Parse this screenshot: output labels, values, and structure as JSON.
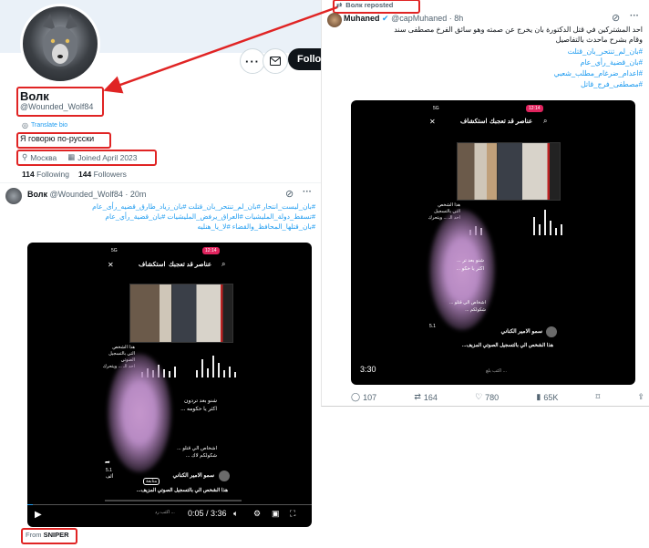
{
  "profile": {
    "display_name": "Волк",
    "handle": "@Wounded_Wolf84",
    "translate_bio": "Translate bio",
    "bio": "Я говорю по-русски",
    "location": "Москва",
    "joined": "Joined April 2023",
    "following_count": "114",
    "following_label": "Following",
    "followers_count": "144",
    "followers_label": "Followers",
    "follow_label": "Follow"
  },
  "tweet1": {
    "author": "Волк",
    "handle_time": "@Wounded_Wolf84 · 20m",
    "text_line1": "#بان_ليست_انتحار #بان_لم_تنتحر_بان_قتلت #بان_زياد_طارق_قضيه_رأى_عام",
    "text_line2": "#تسقط_دولة_المليشيات #العراق_يرفض_المليشيات #بان_قضية_رأي_عام",
    "text_line3": "#بان_قتلها_المحافظ_والقضاء #لا_يا_هنليه",
    "media": {
      "status_left": "5G",
      "status_time": "12:14",
      "tab_left": "استكشاف",
      "tab_right": "عناصر قد تعجبك",
      "caption_lines": [
        "هذا الشخص",
        "التي بالتسجيل الصوتي",
        "احد الـ ...  ويتحرك"
      ],
      "text_a": "شنو بعد تردون",
      "text_b": "اكثر يا حكومه ...",
      "text_c": "اشخاص الي قتلو ...",
      "text_d": "شكولكم لاك ...",
      "counter": "5.1",
      "counter_sub": "ألف",
      "username": "سمو الامير الكناني",
      "follow_btn": "متابعة",
      "caption": "هذا الشخص الي بالتسجيل الصوتي المزيف...",
      "reply_hint": "اكتب رد ...",
      "time": "0:05 / 3:36"
    },
    "source_prefix": "From",
    "source_name": "SNIPER"
  },
  "tweet2": {
    "repost_label": "Волк reposted",
    "author": "Muhaned",
    "handle_time": "@capMuhaned · 8h",
    "text_line1": "احد المشتركين في قتل الدكتورة بان يخرج عن صمته وهو سائق الفرخ مصطفى سند",
    "text_line2": "وقام بشرح ماحدث بالتفاصيل",
    "hashtags": [
      "#بان_لم_تنتحر_بان_قتلت",
      "#بان_قضية_رأي_عام",
      "#اعدام_ضرغام_مطلب_شعبي",
      "#مصطفى_فرج_قاتل"
    ],
    "media": {
      "status_left": "5G",
      "status_time": "12:14",
      "tab_left": "استكشاف",
      "tab_right": "عناصر قد تعجبك",
      "caption_lines": [
        "هذا الشخص",
        "التي بالتسجيل",
        "احد الـ ... ويتحرك"
      ],
      "text_a": "شنو بعد تر ...",
      "text_b": "اكثر يا حكو ...",
      "text_c": "اشخاص الي قتلو ...",
      "text_d": "شكولكم ...",
      "counter": "5.1",
      "username": "سمو الامير الكناني",
      "caption": "هذا الشخص الي بالتسجيل الصوتي المزيف...",
      "reply_hint": "اكتب بلغ ...",
      "duration": "3:30"
    },
    "actions": {
      "replies": "107",
      "reposts": "164",
      "likes": "780",
      "views": "65K"
    }
  },
  "colors": {
    "accent": "#1d9bf0",
    "annotation_red": "#e02424",
    "media_bg": "#000000",
    "badge_red": "#e0245e"
  }
}
